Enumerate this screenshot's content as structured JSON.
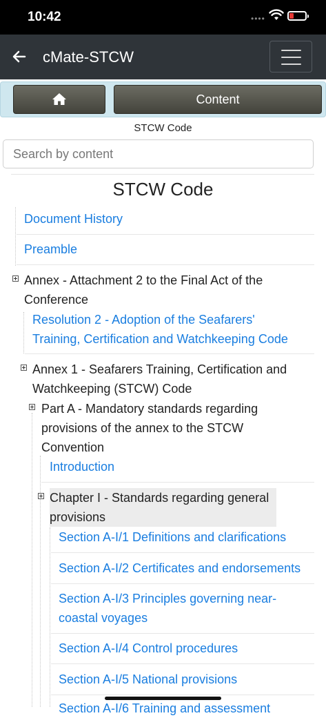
{
  "status": {
    "time": "10:42"
  },
  "appbar": {
    "title": "cMate-STCW"
  },
  "nav": {
    "content_label": "Content"
  },
  "subtitle": "STCW Code",
  "search": {
    "placeholder": "Search by content"
  },
  "doc_title": "STCW Code",
  "tree": {
    "document_history": "Document History",
    "preamble": "Preamble",
    "annex_attachment": [
      "Annex - Attachment 2 to the Final Act of the",
      "Conference"
    ],
    "resolution2": [
      "Resolution 2 - Adoption of the Seafarers'",
      "Training, Certification and Watchkeeping Code"
    ],
    "annex1": [
      "Annex 1 - Seafarers Training, Certification and",
      "Watchkeeping (STCW) Code"
    ],
    "part_a": [
      "Part A - Mandatory standards regarding",
      "provisions of the annex to the STCW",
      "Convention"
    ],
    "introduction": "Introduction",
    "chapter1": [
      "Chapter I - Standards regarding general",
      "provisions"
    ],
    "sections": [
      "Section A-I/1 Definitions and clarifications",
      "Section A-I/2 Certificates and endorsements",
      "Section A-I/3 Principles governing near-",
      "coastal voyages",
      "Section A-I/4 Control procedures",
      "Section A-I/5 National provisions",
      "Section A-I/6 Training and assessment"
    ]
  }
}
